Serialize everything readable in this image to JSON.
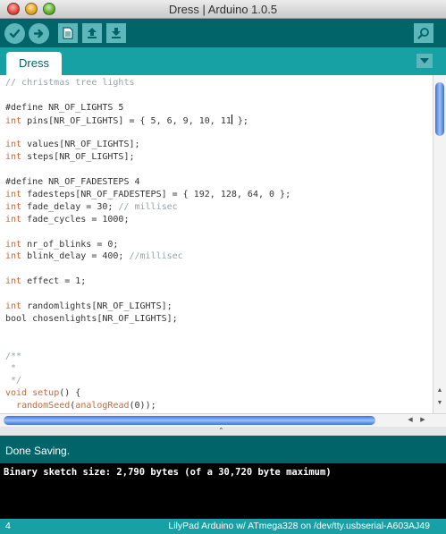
{
  "window": {
    "title": "Dress | Arduino 1.0.5"
  },
  "toolbar": {
    "buttons": [
      {
        "name": "verify",
        "icon": "checkmark-icon"
      },
      {
        "name": "upload",
        "icon": "right-arrow-icon"
      },
      {
        "name": "new",
        "icon": "new-document-icon"
      },
      {
        "name": "open",
        "icon": "up-arrow-icon"
      },
      {
        "name": "save",
        "icon": "down-arrow-icon"
      },
      {
        "name": "serial-monitor",
        "icon": "magnifier-icon"
      }
    ]
  },
  "tabs": [
    {
      "label": "Dress",
      "active": true
    }
  ],
  "editor": {
    "lines": [
      [
        {
          "t": "// christmas tree lights",
          "c": "comment"
        }
      ],
      [],
      [
        {
          "t": "#define NR_OF_LIGHTS 5",
          "c": "plain"
        }
      ],
      [
        {
          "t": "int",
          "c": "keyword"
        },
        {
          "t": " pins[NR_OF_LIGHTS] = { 5, 6, 9, 10, 11",
          "c": "plain"
        },
        {
          "t": "|caret|",
          "c": "caret"
        },
        {
          "t": " };",
          "c": "plain"
        }
      ],
      [],
      [
        {
          "t": "int",
          "c": "keyword"
        },
        {
          "t": " values[NR_OF_LIGHTS];",
          "c": "plain"
        }
      ],
      [
        {
          "t": "int",
          "c": "keyword"
        },
        {
          "t": " steps[NR_OF_LIGHTS];",
          "c": "plain"
        }
      ],
      [],
      [
        {
          "t": "#define NR_OF_FADESTEPS 4",
          "c": "plain"
        }
      ],
      [
        {
          "t": "int",
          "c": "keyword"
        },
        {
          "t": " fadesteps[NR_OF_FADESTEPS] = { 192, 128, 64, 0 };",
          "c": "plain"
        }
      ],
      [
        {
          "t": "int",
          "c": "keyword"
        },
        {
          "t": " fade_delay = 30; ",
          "c": "plain"
        },
        {
          "t": "// millisec",
          "c": "comment"
        }
      ],
      [
        {
          "t": "int",
          "c": "keyword"
        },
        {
          "t": " fade_cycles = 1000;",
          "c": "plain"
        }
      ],
      [],
      [
        {
          "t": "int",
          "c": "keyword"
        },
        {
          "t": " nr_of_blinks = 0;",
          "c": "plain"
        }
      ],
      [
        {
          "t": "int",
          "c": "keyword"
        },
        {
          "t": " blink_delay = 400; ",
          "c": "plain"
        },
        {
          "t": "//millisec",
          "c": "comment"
        }
      ],
      [],
      [
        {
          "t": "int",
          "c": "keyword"
        },
        {
          "t": " effect = 1;",
          "c": "plain"
        }
      ],
      [],
      [
        {
          "t": "int",
          "c": "keyword"
        },
        {
          "t": " randomlights[NR_OF_LIGHTS];",
          "c": "plain"
        }
      ],
      [
        {
          "t": "bool chosenlights[NR_OF_LIGHTS];",
          "c": "plain"
        }
      ],
      [],
      [],
      [
        {
          "t": "/**",
          "c": "comment"
        }
      ],
      [
        {
          "t": " *",
          "c": "comment"
        }
      ],
      [
        {
          "t": " */",
          "c": "comment"
        }
      ],
      [
        {
          "t": "void",
          "c": "keyword"
        },
        {
          "t": " ",
          "c": "plain"
        },
        {
          "t": "setup",
          "c": "func"
        },
        {
          "t": "() {",
          "c": "plain"
        }
      ],
      [
        {
          "t": "  ",
          "c": "plain"
        },
        {
          "t": "randomSeed",
          "c": "call"
        },
        {
          "t": "(",
          "c": "plain"
        },
        {
          "t": "analogRead",
          "c": "call"
        },
        {
          "t": "(0));",
          "c": "plain"
        }
      ]
    ]
  },
  "status": {
    "message": "Done Saving."
  },
  "console": {
    "output": "Binary sketch size: 2,790 bytes (of a 30,720 byte maximum)"
  },
  "footer": {
    "line_number": "4",
    "board": "LilyPad Arduino w/ ATmega328 on /dev/tty.usbserial-A603AJ49"
  },
  "colors": {
    "toolbar": "#006468",
    "tabstrip": "#17a1a5",
    "button": "#5cb6ba",
    "keyword": "#cc6633",
    "comment": "#95a5a6"
  }
}
